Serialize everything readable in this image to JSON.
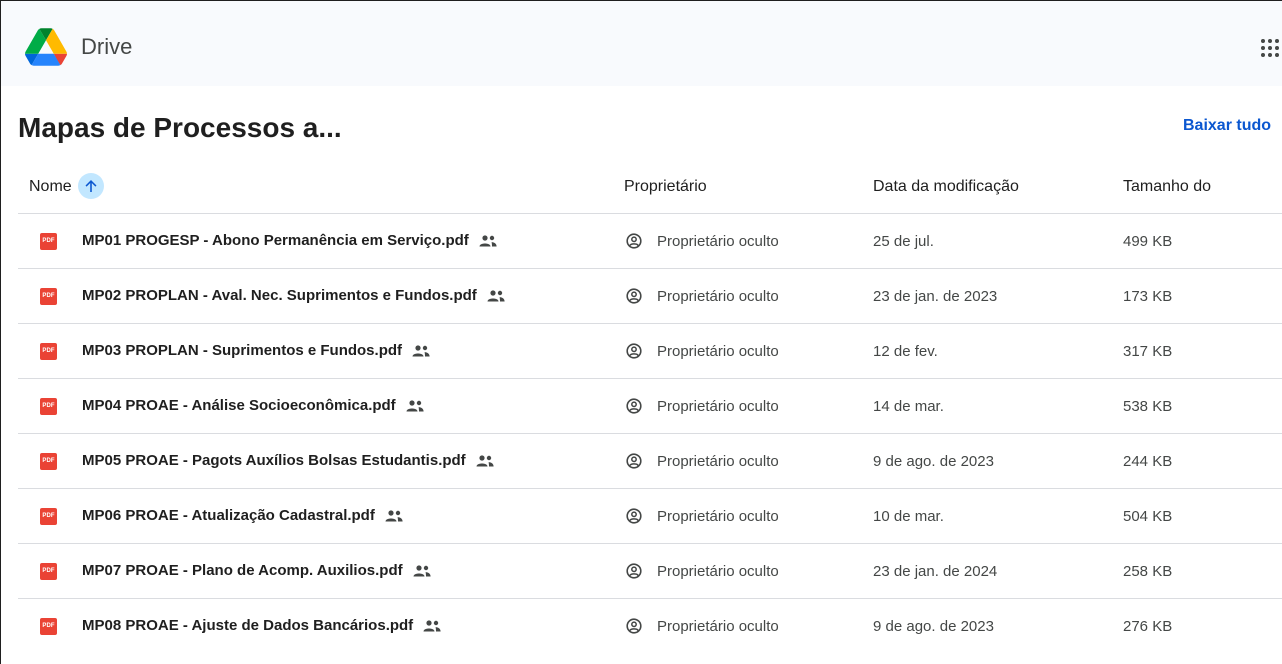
{
  "app": {
    "name": "Drive"
  },
  "folder": {
    "title": "Mapas de Processos a...",
    "download_label": "Baixar tudo"
  },
  "columns": {
    "name": "Nome",
    "owner": "Proprietário",
    "modified": "Data da modificação",
    "size": "Tamanho do"
  },
  "sort": {
    "direction": "ascending",
    "icon": "arrow-up-icon"
  },
  "icons": {
    "file": "pdf-icon",
    "shared": "shared-people-icon",
    "owner": "account-circle-icon",
    "apps": "apps-grid-icon"
  },
  "colors": {
    "accent": "#0b57d0",
    "pdf": "#ea4335",
    "sort_bg": "#c2e7ff",
    "topbar_bg": "#f8fafd"
  },
  "pdf_badge": "PDF",
  "files": [
    {
      "name": "MP01 PROGESP - Abono Permanência em Serviço.pdf",
      "owner": "Proprietário oculto",
      "modified": "25 de jul.",
      "size": "499 KB"
    },
    {
      "name": "MP02 PROPLAN - Aval. Nec. Suprimentos e Fundos.pdf",
      "owner": "Proprietário oculto",
      "modified": "23 de jan. de 2023",
      "size": "173 KB"
    },
    {
      "name": "MP03 PROPLAN - Suprimentos e Fundos.pdf",
      "owner": "Proprietário oculto",
      "modified": "12 de fev.",
      "size": "317 KB"
    },
    {
      "name": "MP04 PROAE - Análise Socioeconômica.pdf",
      "owner": "Proprietário oculto",
      "modified": "14 de mar.",
      "size": "538 KB"
    },
    {
      "name": "MP05 PROAE - Pagots Auxílios Bolsas Estudantis.pdf",
      "owner": "Proprietário oculto",
      "modified": "9 de ago. de 2023",
      "size": "244 KB"
    },
    {
      "name": "MP06 PROAE - Atualização Cadastral.pdf",
      "owner": "Proprietário oculto",
      "modified": "10 de mar.",
      "size": "504 KB"
    },
    {
      "name": "MP07 PROAE - Plano de Acomp. Auxilios.pdf",
      "owner": "Proprietário oculto",
      "modified": "23 de jan. de 2024",
      "size": "258 KB"
    },
    {
      "name": "MP08 PROAE - Ajuste de Dados Bancários.pdf",
      "owner": "Proprietário oculto",
      "modified": "9 de ago. de 2023",
      "size": "276 KB"
    }
  ]
}
